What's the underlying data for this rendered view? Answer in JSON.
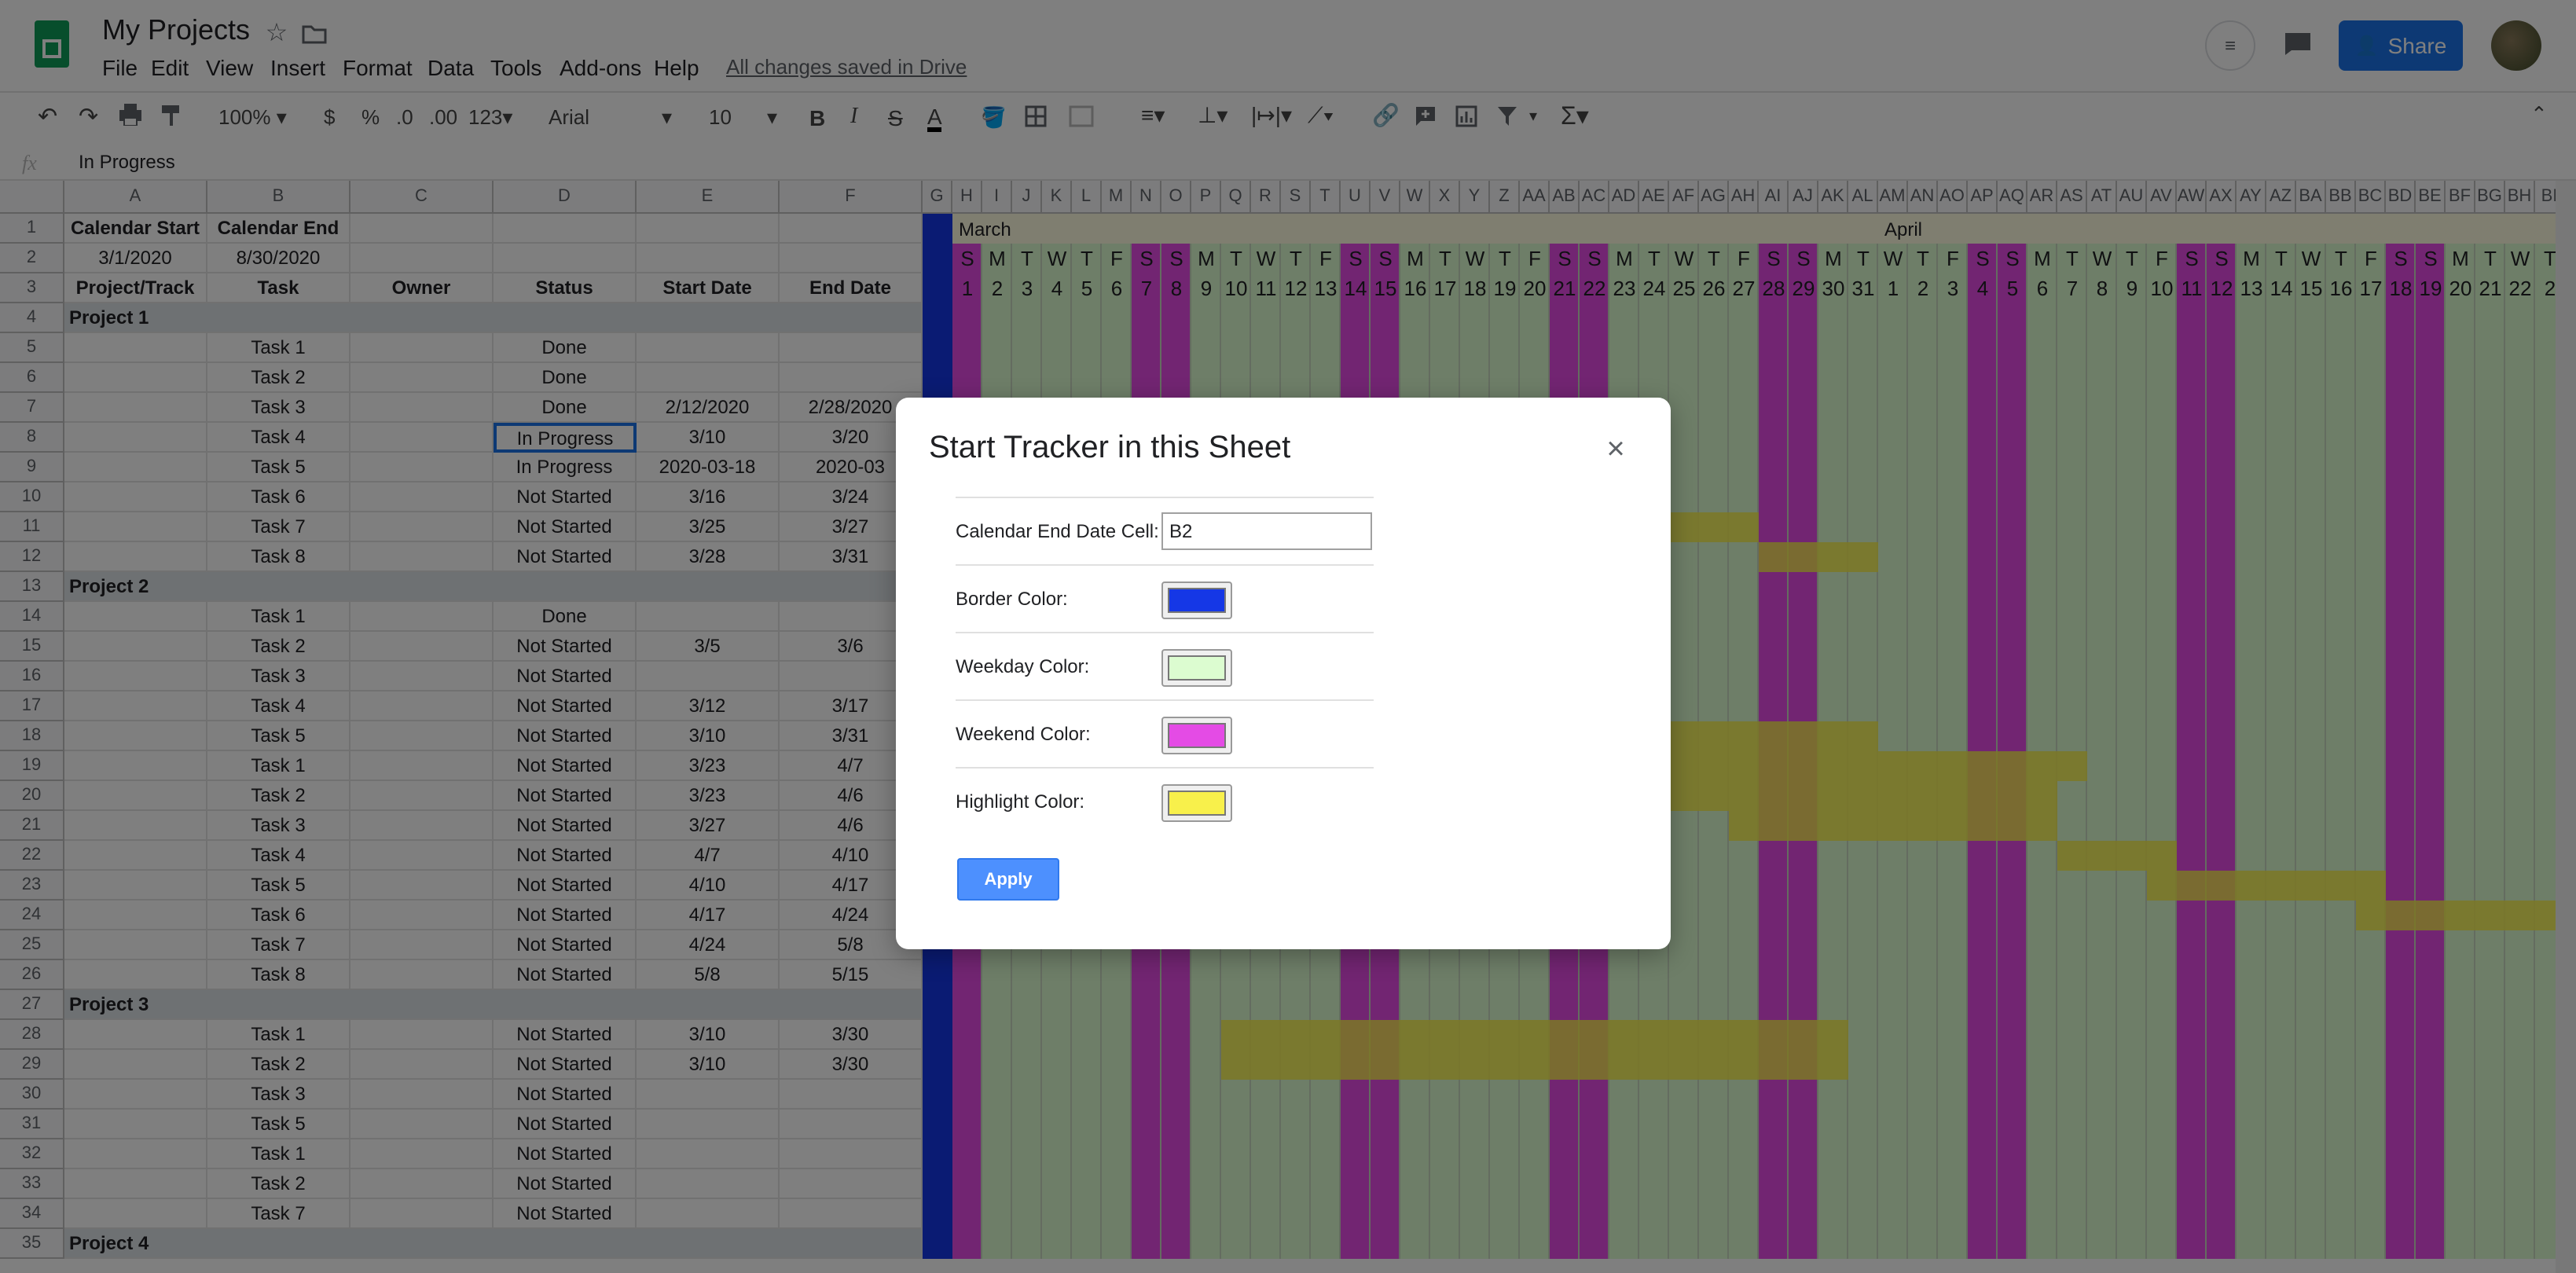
{
  "app": {
    "doc_title": "My Projects",
    "menus": [
      "File",
      "Edit",
      "View",
      "Insert",
      "Format",
      "Data",
      "Tools",
      "Add-ons",
      "Help"
    ],
    "save_status": "All changes saved in Drive",
    "share_label": "Share"
  },
  "toolbar": {
    "zoom": "100%",
    "currency": "$",
    "percent": "%",
    "dec_less": ".0",
    "dec_more": ".00",
    "num_format": "123",
    "font": "Arial",
    "font_size": "10",
    "bold": "B",
    "italic": "I",
    "strike": "S",
    "text_color": "A"
  },
  "formula_bar": {
    "fx": "fx",
    "value": "In Progress"
  },
  "colors": {
    "border": "#1537e6",
    "weekday": "#dcfcd0",
    "weekend": "#e44be5",
    "highlight": "#f8f04b",
    "section": "#dde3e6"
  },
  "sheet": {
    "columns": [
      "A",
      "B",
      "C",
      "D",
      "E",
      "F"
    ],
    "gantt_columns": [
      "G",
      "H",
      "I",
      "J",
      "K",
      "L",
      "M",
      "N",
      "O",
      "P",
      "Q",
      "R",
      "S",
      "T",
      "U",
      "V",
      "W",
      "X",
      "Y",
      "Z",
      "AA",
      "AB",
      "AC",
      "AD",
      "AE",
      "AF",
      "AG",
      "AH",
      "AI",
      "AJ",
      "AK",
      "AL",
      "AM",
      "AN",
      "AO",
      "AP",
      "AQ",
      "AR",
      "AS",
      "AT",
      "AU",
      "AV",
      "AW",
      "AX",
      "AY",
      "AZ",
      "BA",
      "BB",
      "BC",
      "BD",
      "BE",
      "BF",
      "BG",
      "BH",
      "BI"
    ],
    "row_numbers": [
      "1",
      "2",
      "3",
      "4",
      "5",
      "6",
      "7",
      "8",
      "9",
      "10",
      "11",
      "12",
      "13",
      "14",
      "15",
      "16",
      "17",
      "18",
      "19",
      "20",
      "21",
      "22",
      "23",
      "24",
      "25",
      "26",
      "27",
      "28",
      "29",
      "30",
      "31",
      "32",
      "33",
      "34",
      "35"
    ],
    "headers": {
      "cal_start_label": "Calendar Start",
      "cal_end_label": "Calendar End",
      "cal_start": "3/1/2020",
      "cal_end": "8/30/2020",
      "col_project": "Project/Track",
      "col_task": "Task",
      "col_owner": "Owner",
      "col_status": "Status",
      "col_start": "Start Date",
      "col_end": "End Date"
    },
    "months": [
      "March",
      "April"
    ],
    "day_letters": [
      "S",
      "M",
      "T",
      "W",
      "T",
      "F",
      "S",
      "S",
      "M",
      "T",
      "W",
      "T",
      "F",
      "S",
      "S",
      "M",
      "T",
      "W",
      "T",
      "F",
      "S",
      "S",
      "M",
      "T",
      "W",
      "T",
      "F",
      "S",
      "S",
      "M",
      "T",
      "W",
      "T",
      "F",
      "S",
      "S",
      "M",
      "T",
      "W",
      "T",
      "F",
      "S",
      "S",
      "M",
      "T",
      "W",
      "T",
      "F",
      "S",
      "S",
      "M",
      "T",
      "W",
      "T"
    ],
    "day_numbers": [
      "1",
      "2",
      "3",
      "4",
      "5",
      "6",
      "7",
      "8",
      "9",
      "10",
      "11",
      "12",
      "13",
      "14",
      "15",
      "16",
      "17",
      "18",
      "19",
      "20",
      "21",
      "22",
      "23",
      "24",
      "25",
      "26",
      "27",
      "28",
      "29",
      "30",
      "31",
      "1",
      "2",
      "3",
      "4",
      "5",
      "6",
      "7",
      "8",
      "9",
      "10",
      "11",
      "12",
      "13",
      "14",
      "15",
      "16",
      "17",
      "18",
      "19",
      "20",
      "21",
      "22",
      "2"
    ],
    "rows": [
      {
        "r": 4,
        "section": "Project 1"
      },
      {
        "r": 5,
        "task": "Task 1",
        "status": "Done",
        "start": "",
        "end": ""
      },
      {
        "r": 6,
        "task": "Task 2",
        "status": "Done",
        "start": "",
        "end": ""
      },
      {
        "r": 7,
        "task": "Task 3",
        "status": "Done",
        "start": "2/12/2020",
        "end": "2/28/2020"
      },
      {
        "r": 8,
        "task": "Task 4",
        "status": "In Progress",
        "start": "3/10",
        "end": "3/20"
      },
      {
        "r": 9,
        "task": "Task 5",
        "status": "In Progress",
        "start": "2020-03-18",
        "end": "2020-03"
      },
      {
        "r": 10,
        "task": "Task 6",
        "status": "Not Started",
        "start": "3/16",
        "end": "3/24"
      },
      {
        "r": 11,
        "task": "Task 7",
        "status": "Not Started",
        "start": "3/25",
        "end": "3/27"
      },
      {
        "r": 12,
        "task": "Task 8",
        "status": "Not Started",
        "start": "3/28",
        "end": "3/31"
      },
      {
        "r": 13,
        "section": "Project 2"
      },
      {
        "r": 14,
        "task": "Task 1",
        "status": "Done",
        "start": "",
        "end": ""
      },
      {
        "r": 15,
        "task": "Task 2",
        "status": "Not Started",
        "start": "3/5",
        "end": "3/6"
      },
      {
        "r": 16,
        "task": "Task 3",
        "status": "Not Started",
        "start": "",
        "end": ""
      },
      {
        "r": 17,
        "task": "Task 4",
        "status": "Not Started",
        "start": "3/12",
        "end": "3/17"
      },
      {
        "r": 18,
        "task": "Task 5",
        "status": "Not Started",
        "start": "3/10",
        "end": "3/31"
      },
      {
        "r": 19,
        "task": "Task 1",
        "status": "Not Started",
        "start": "3/23",
        "end": "4/7"
      },
      {
        "r": 20,
        "task": "Task 2",
        "status": "Not Started",
        "start": "3/23",
        "end": "4/6"
      },
      {
        "r": 21,
        "task": "Task 3",
        "status": "Not Started",
        "start": "3/27",
        "end": "4/6"
      },
      {
        "r": 22,
        "task": "Task 4",
        "status": "Not Started",
        "start": "4/7",
        "end": "4/10"
      },
      {
        "r": 23,
        "task": "Task 5",
        "status": "Not Started",
        "start": "4/10",
        "end": "4/17"
      },
      {
        "r": 24,
        "task": "Task 6",
        "status": "Not Started",
        "start": "4/17",
        "end": "4/24"
      },
      {
        "r": 25,
        "task": "Task 7",
        "status": "Not Started",
        "start": "4/24",
        "end": "5/8"
      },
      {
        "r": 26,
        "task": "Task 8",
        "status": "Not Started",
        "start": "5/8",
        "end": "5/15"
      },
      {
        "r": 27,
        "section": "Project 3"
      },
      {
        "r": 28,
        "task": "Task 1",
        "status": "Not Started",
        "start": "3/10",
        "end": "3/30"
      },
      {
        "r": 29,
        "task": "Task 2",
        "status": "Not Started",
        "start": "3/10",
        "end": "3/30"
      },
      {
        "r": 30,
        "task": "Task 3",
        "status": "Not Started",
        "start": "",
        "end": ""
      },
      {
        "r": 31,
        "task": "Task 5",
        "status": "Not Started",
        "start": "",
        "end": ""
      },
      {
        "r": 32,
        "task": "Task 1",
        "status": "Not Started",
        "start": "",
        "end": ""
      },
      {
        "r": 33,
        "task": "Task 2",
        "status": "Not Started",
        "start": "",
        "end": ""
      },
      {
        "r": 34,
        "task": "Task 7",
        "status": "Not Started",
        "start": "",
        "end": ""
      },
      {
        "r": 35,
        "section": "Project 4"
      }
    ]
  },
  "dialog": {
    "title": "Start Tracker in this Sheet",
    "close": "×",
    "fields": [
      {
        "label": "Calendar End Date Cell:",
        "value": "B2"
      },
      {
        "label": "Border Color:",
        "color": "#1537e6"
      },
      {
        "label": "Weekday Color:",
        "color": "#dcfcd0"
      },
      {
        "label": "Weekend Color:",
        "color": "#e44be5"
      },
      {
        "label": "Highlight Color:",
        "color": "#f8f04b"
      }
    ],
    "apply_label": "Apply"
  }
}
